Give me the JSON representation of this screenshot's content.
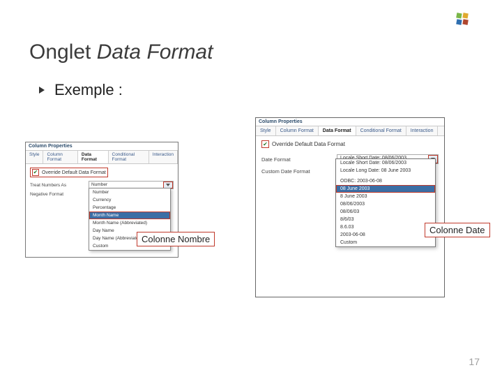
{
  "slide": {
    "title_plain": "Onglet ",
    "title_italic": "Data Format",
    "bullet": "Exemple :",
    "page_number": "17"
  },
  "panel_left": {
    "window_title": "Column Properties",
    "tabs": [
      "Style",
      "Column Format",
      "Data Format",
      "Conditional Format",
      "Interaction"
    ],
    "active_tab_index": 2,
    "checkbox_label": "Override Default Data Format",
    "field1_label": "Treat Numbers As",
    "field1_value": "Number",
    "field2_label": "Negative Format",
    "options": [
      "Number",
      "Currency",
      "Percentage",
      "Month Name",
      "Month Name (Abbreviated)",
      "Day Name",
      "Day Name (Abbreviated)",
      "Custom"
    ],
    "selected_option_index": 3
  },
  "panel_right": {
    "window_title": "Column Properties",
    "tabs": [
      "Style",
      "Column Format",
      "Data Format",
      "Conditional Format",
      "Interaction"
    ],
    "active_tab_index": 2,
    "checkbox_label": "Override Default Data Format",
    "field1_label": "Date Format",
    "field1_value": "Locale Short Date: 08/06/2003",
    "field2_label": "Custom Date Format",
    "options": [
      "Locale Short Date: 08/06/2003",
      "Locale Long Date: 08 June 2003",
      "",
      "ODBC: 2003-06-08",
      "08 June 2003",
      "8 June 2003",
      "08/06/2003",
      "08/06/03",
      "8/6/03",
      "8.6.03",
      "2003-06-08",
      "Custom"
    ],
    "selected_option_index": 4
  },
  "callouts": {
    "left": "Colonne Nombre",
    "right": "Colonne Date"
  }
}
